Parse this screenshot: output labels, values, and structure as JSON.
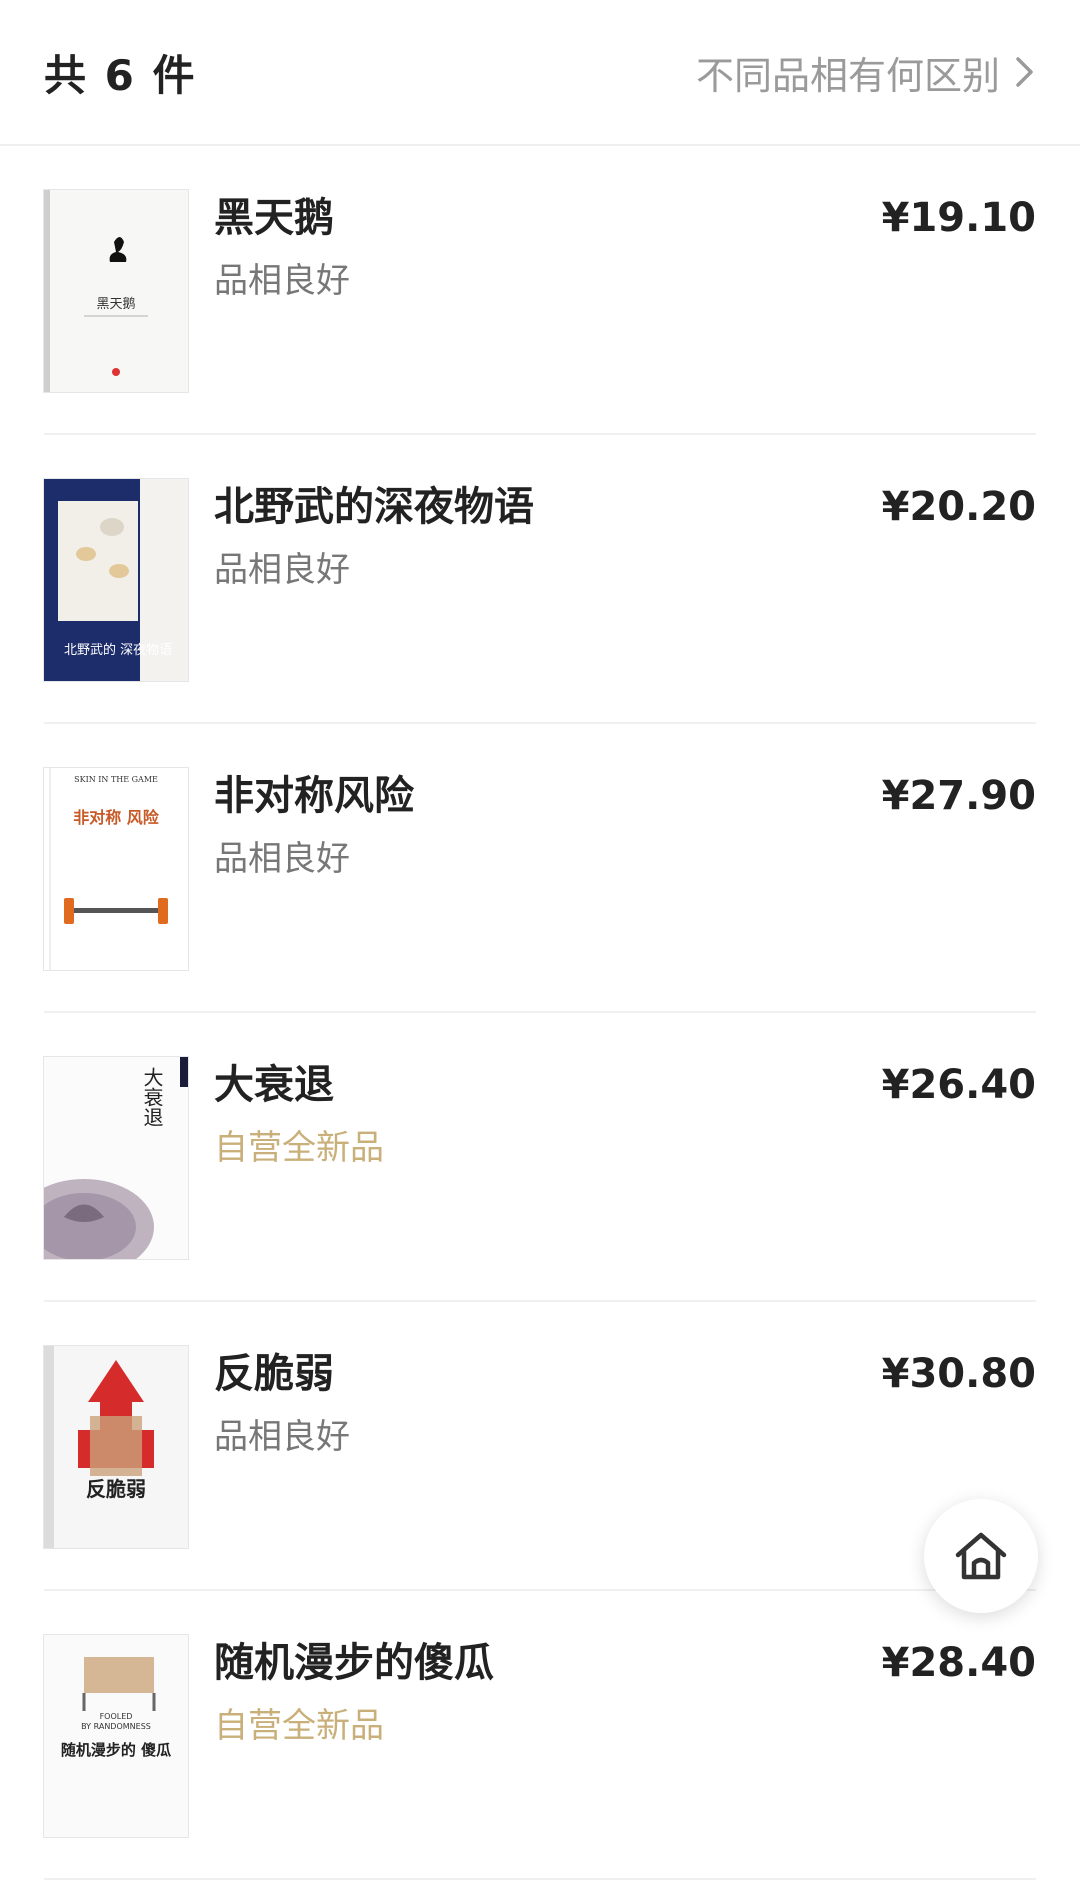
{
  "header": {
    "count_label": "共 6 件",
    "condition_help_label": "不同品相有何区别"
  },
  "items": [
    {
      "title": "黑天鹅",
      "condition": "品相良好",
      "price": "¥19.10",
      "condition_type": "used",
      "cover_text": "黑天鹅"
    },
    {
      "title": "北野武的深夜物语",
      "condition": "品相良好",
      "price": "¥20.20",
      "condition_type": "used",
      "cover_text": "北野武的 深夜物语"
    },
    {
      "title": "非对称风险",
      "condition": "品相良好",
      "price": "¥27.90",
      "condition_type": "used",
      "cover_text": "非对称 风险"
    },
    {
      "title": "大衰退",
      "condition": "自营全新品",
      "price": "¥26.40",
      "condition_type": "new",
      "cover_text": "大衰退"
    },
    {
      "title": "反脆弱",
      "condition": "品相良好",
      "price": "¥30.80",
      "condition_type": "used",
      "cover_text": "反脆弱"
    },
    {
      "title": "随机漫步的傻瓜",
      "condition": "自营全新品",
      "price": "¥28.40",
      "condition_type": "new",
      "cover_text": "随机漫步的 傻瓜"
    }
  ],
  "floating": {
    "home_icon": "home-icon"
  },
  "colors": {
    "new_condition": "#c9b07a",
    "used_condition": "#777777",
    "divider": "#f0f0f0"
  }
}
